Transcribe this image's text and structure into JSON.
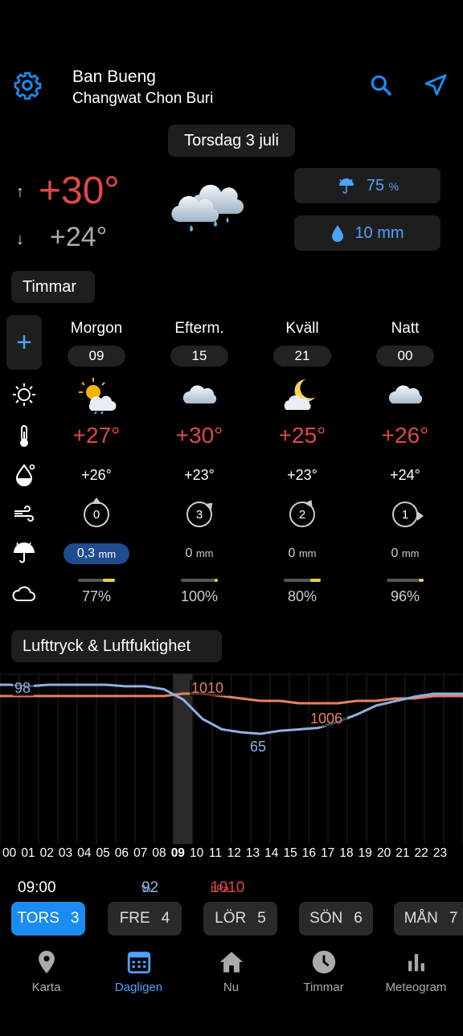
{
  "header": {
    "location_name": "Ban Bueng",
    "location_region": "Changwat Chon Buri",
    "date": "Torsdag 3 juli"
  },
  "today": {
    "max_temp": "+30°",
    "min_temp": "+24°",
    "rain_chance": "75",
    "rain_chance_unit": "%",
    "precip_amount": "10 mm",
    "arrow_up": "↑",
    "arrow_down": "↓"
  },
  "sections": {
    "hours": "Timmar",
    "pressure": "Lufttryck & Luftfuktighet",
    "plus": "+"
  },
  "periods": [
    {
      "label": "Morgon",
      "hour": "09",
      "temp": "+27°",
      "feels": "+26°",
      "wind": "0",
      "precip": "0,3",
      "precip_unit": "mm",
      "clouds": "77%",
      "cloud_fraction": 0.77,
      "icon": "sun-cloud-rain-icon"
    },
    {
      "label": "Efterm.",
      "hour": "15",
      "temp": "+30°",
      "feels": "+23°",
      "wind": "3",
      "precip": "0",
      "precip_unit": "mm",
      "clouds": "100%",
      "cloud_fraction": 1.0,
      "icon": "cloud-icon"
    },
    {
      "label": "Kväll",
      "hour": "21",
      "temp": "+25°",
      "feels": "+23°",
      "wind": "2",
      "precip": "0",
      "precip_unit": "mm",
      "clouds": "80%",
      "cloud_fraction": 0.8,
      "icon": "moon-cloud-icon"
    },
    {
      "label": "Natt",
      "hour": "00",
      "temp": "+26°",
      "feels": "+24°",
      "wind": "1",
      "precip": "0",
      "precip_unit": "mm",
      "clouds": "96%",
      "cloud_fraction": 0.96,
      "icon": "cloud-icon"
    }
  ],
  "chart_data": {
    "type": "line",
    "x": [
      "00",
      "01",
      "02",
      "03",
      "04",
      "05",
      "06",
      "07",
      "08",
      "09",
      "10",
      "11",
      "12",
      "13",
      "14",
      "15",
      "16",
      "17",
      "18",
      "19",
      "20",
      "21",
      "22",
      "23"
    ],
    "series": [
      {
        "name": "",
        "color": "#8fb0e0",
        "values": [
          98,
          97,
          98,
          98,
          98,
          98,
          97,
          97,
          95,
          88,
          75,
          68,
          66,
          65,
          67,
          68,
          69,
          73,
          78,
          84,
          87,
          90,
          92,
          92
        ]
      },
      {
        "name": "",
        "color": "#e8805f",
        "values": [
          1009,
          1009,
          1009,
          1009,
          1009,
          1009,
          1009,
          1009,
          1009,
          1010,
          1010,
          1009,
          1008,
          1007,
          1007,
          1006,
          1006,
          1006,
          1007,
          1007,
          1008,
          1008,
          1009,
          1009
        ]
      }
    ],
    "labels": {
      "humidity_start": "98",
      "pressure_high": "1010",
      "pressure_low": "1006",
      "humidity_low": "65"
    },
    "current_hour": "09"
  },
  "summary": {
    "time": "09:00",
    "humidity": "92",
    "humidity_unit": "%",
    "pressure": "1010",
    "pressure_unit": "hPa"
  },
  "day_tabs": [
    {
      "day": "TORS",
      "num": "3"
    },
    {
      "day": "FRE",
      "num": "4"
    },
    {
      "day": "LÖR",
      "num": "5"
    },
    {
      "day": "SÖN",
      "num": "6"
    },
    {
      "day": "MÅN",
      "num": "7"
    }
  ],
  "nav": [
    {
      "label": "Karta"
    },
    {
      "label": "Dagligen"
    },
    {
      "label": "Nu"
    },
    {
      "label": "Timmar"
    },
    {
      "label": "Meteogram"
    }
  ],
  "colors": {
    "accent": "#1a8cf2",
    "temp_high": "#e0474a",
    "humidity": "#8fb0e0",
    "pressure": "#e8805f"
  }
}
